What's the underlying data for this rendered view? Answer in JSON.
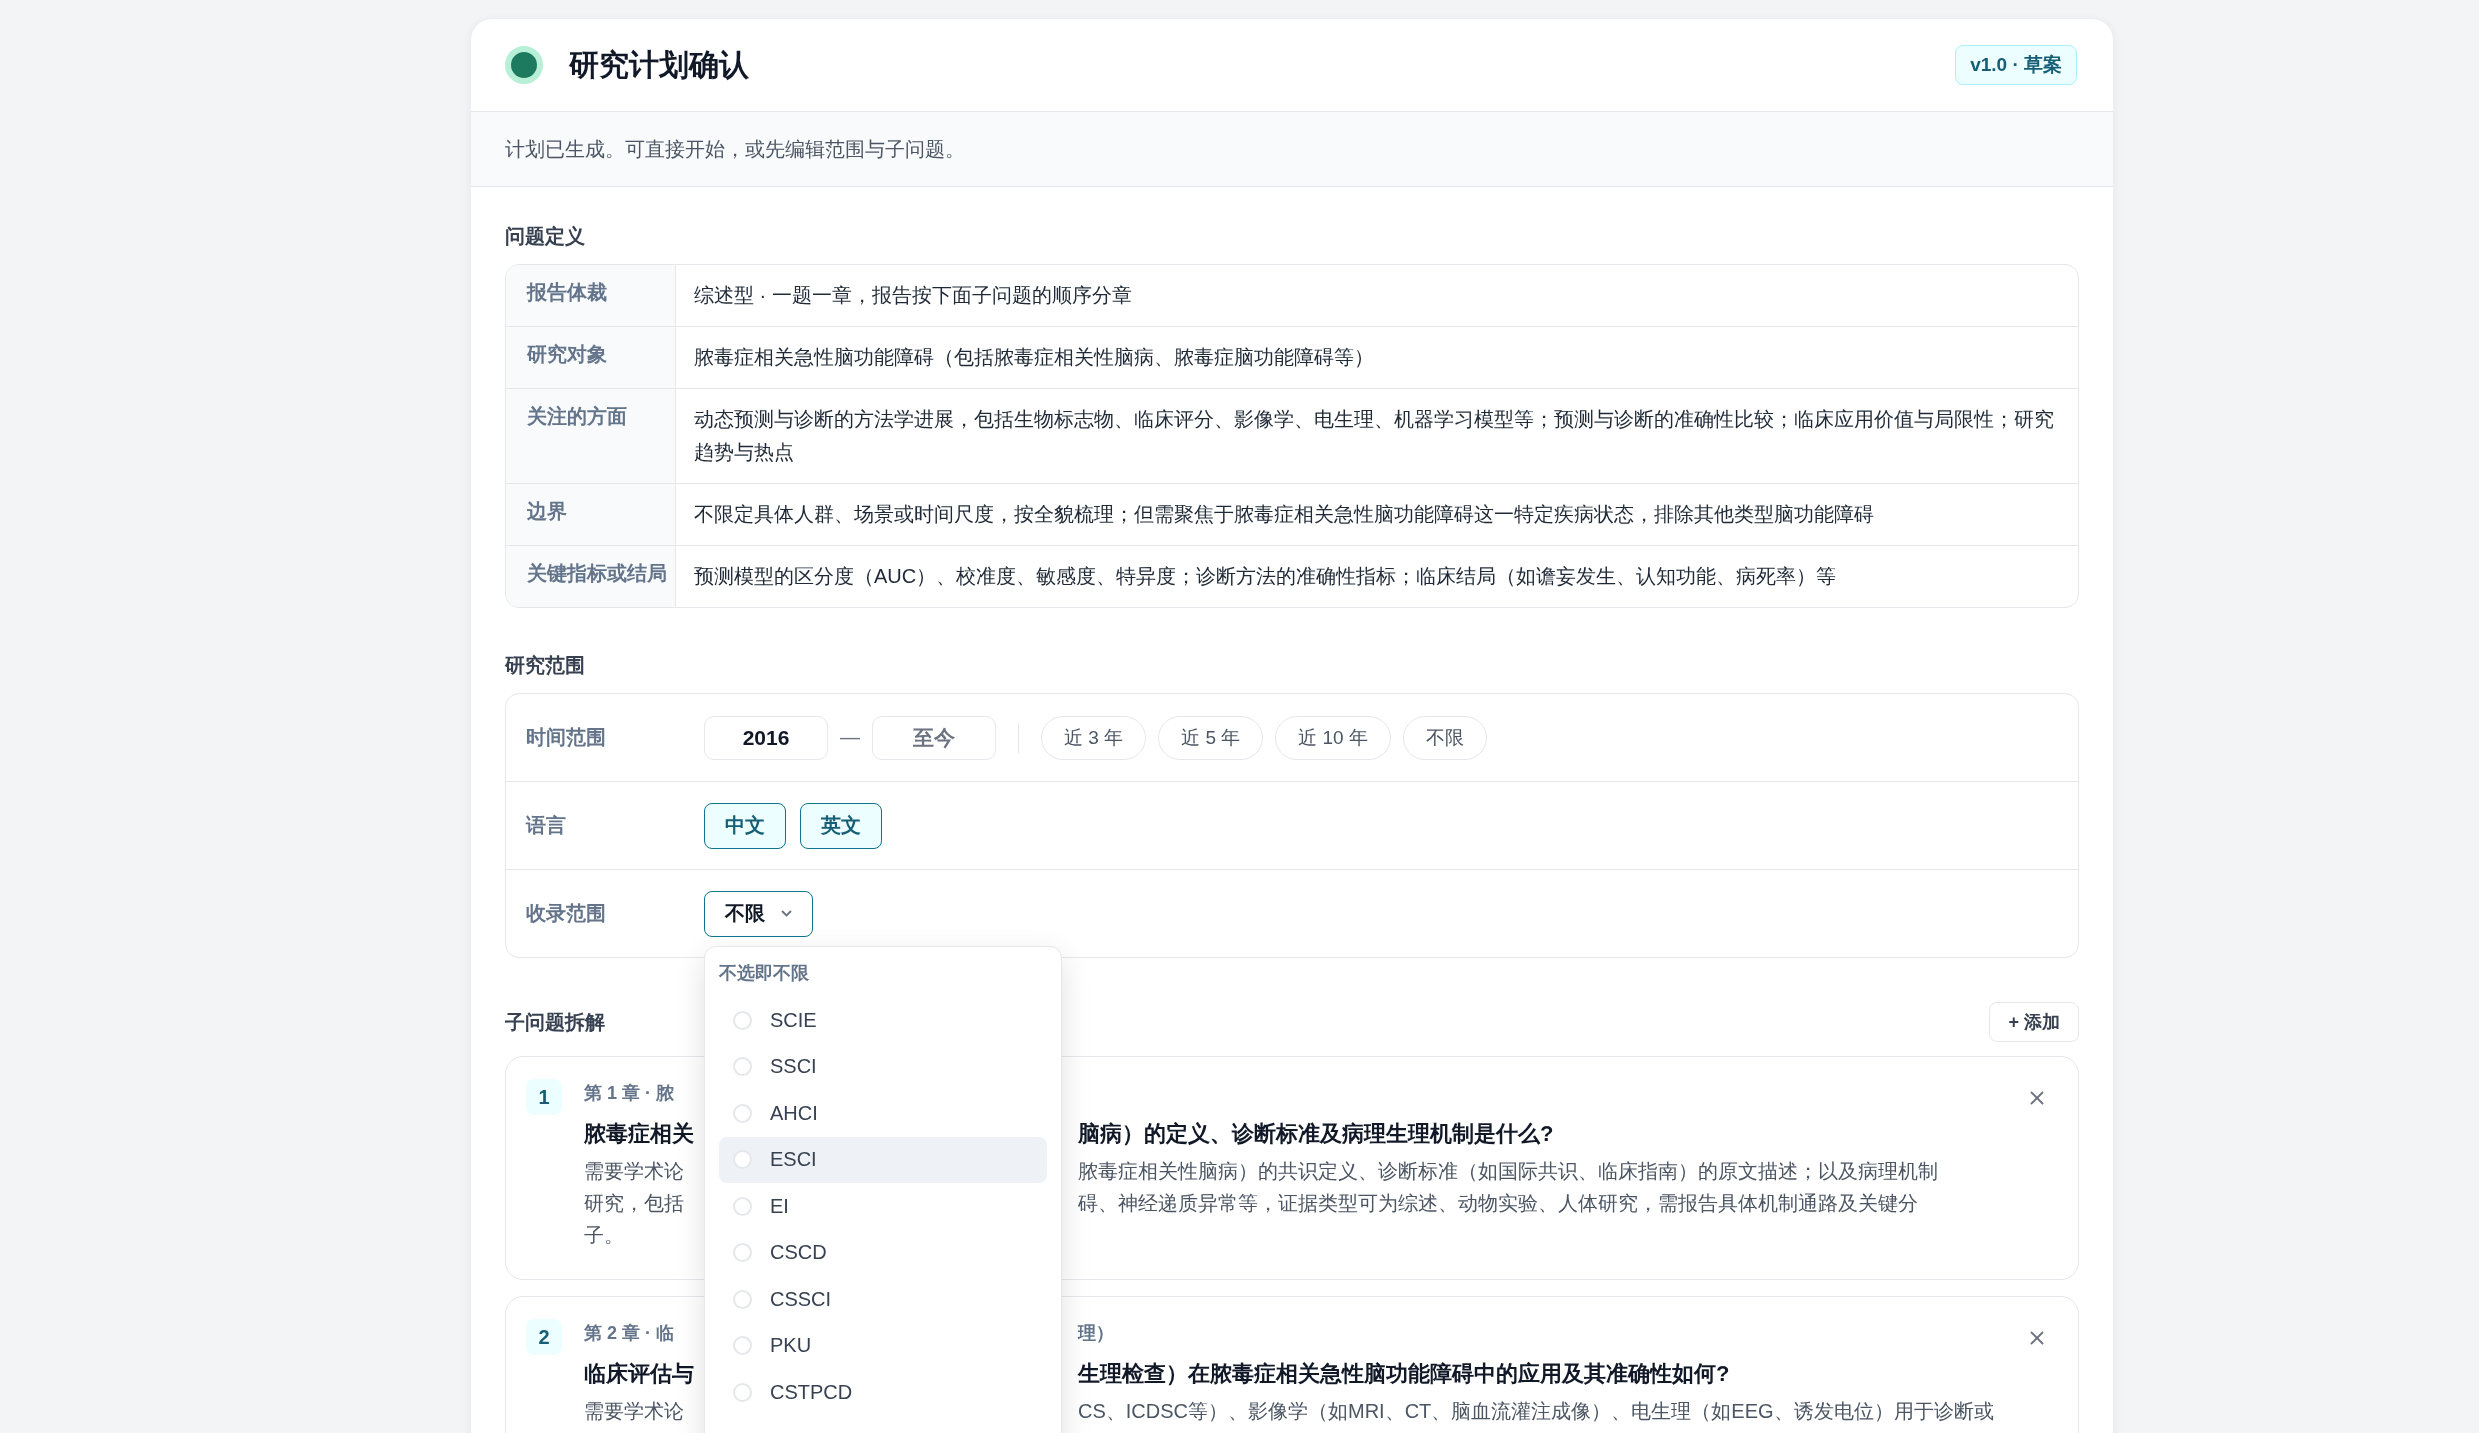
{
  "header": {
    "title": "研究计划确认",
    "badge": "v1.0 · 草案",
    "status_on": true
  },
  "notice": "计划已生成。可直接开始，或先编辑范围与子问题。",
  "definition": {
    "heading": "问题定义",
    "rows": [
      {
        "label": "报告体裁",
        "value": "综述型 · 一题一章，报告按下面子问题的顺序分章"
      },
      {
        "label": "研究对象",
        "value": "脓毒症相关急性脑功能障碍（包括脓毒症相关性脑病、脓毒症脑功能障碍等）"
      },
      {
        "label": "关注的方面",
        "value": "动态预测与诊断的方法学进展，包括生物标志物、临床评分、影像学、电生理、机器学习模型等；预测与诊断的准确性比较；临床应用价值与局限性；研究趋势与热点"
      },
      {
        "label": "边界",
        "value": "不限定具体人群、场景或时间尺度，按全貌梳理；但需聚焦于脓毒症相关急性脑功能障碍这一特定疾病状态，排除其他类型脑功能障碍"
      },
      {
        "label": "关键指标或结局",
        "value": "预测模型的区分度（AUC）、校准度、敏感度、特异度；诊断方法的准确性指标；临床结局（如谵妄发生、认知功能、病死率）等"
      }
    ]
  },
  "scope": {
    "heading": "研究范围",
    "time": {
      "label": "时间范围",
      "from": "2016",
      "separator": "—",
      "to_placeholder": "至今",
      "presets": [
        {
          "label": "近 3 年",
          "selected": false
        },
        {
          "label": "近 5 年",
          "selected": false
        },
        {
          "label": "近 10 年",
          "selected": false
        },
        {
          "label": "不限",
          "selected": false
        }
      ]
    },
    "language": {
      "label": "语言",
      "options": [
        {
          "label": "中文",
          "selected": true
        },
        {
          "label": "英文",
          "selected": true
        }
      ]
    },
    "index": {
      "label": "收录范围",
      "value": "不限",
      "expanded": true,
      "dropdown": {
        "hint": "不选即不限",
        "options": [
          {
            "label": "SCIE",
            "checked": false,
            "hovered": false
          },
          {
            "label": "SSCI",
            "checked": false,
            "hovered": false
          },
          {
            "label": "AHCI",
            "checked": false,
            "hovered": false
          },
          {
            "label": "ESCI",
            "checked": false,
            "hovered": true
          },
          {
            "label": "EI",
            "checked": false,
            "hovered": false
          },
          {
            "label": "CSCD",
            "checked": false,
            "hovered": false
          },
          {
            "label": "CSSCI",
            "checked": false,
            "hovered": false
          },
          {
            "label": "PKU",
            "checked": false,
            "hovered": false
          },
          {
            "label": "CSTPCD",
            "checked": false,
            "hovered": false
          }
        ]
      }
    }
  },
  "subquestions": {
    "heading": "子问题拆解",
    "add_button": "+ 添加",
    "items": [
      {
        "number": "1",
        "meta": [
          "第 1 章 · 脓"
        ],
        "title": [
          "脓毒症相关",
          "脑病）的定义、诊断标准及病理生理机制是什么?"
        ],
        "description": [
          [
            "需要学术论",
            "脓毒症相关性脑病）的共识定义、诊断标准（如国际共识、临床指南）的原文描述；以及病理机制"
          ],
          [
            "研究，包括",
            "碍、神经递质异常等，证据类型可为综述、动物实验、人体研究，需报告具体机制通路及关键分"
          ],
          [
            "子。"
          ]
        ]
      },
      {
        "number": "2",
        "meta": [
          "第 2 章 · 临",
          "理）"
        ],
        "title": [
          "临床评估与",
          "生理检查）在脓毒症相关急性脑功能障碍中的应用及其准确性如何?"
        ],
        "description": [
          [
            "需要学术论",
            "CS、ICDSC等）、影像学（如MRI、CT、脑血流灌注成像）、电生理（如EEG、诱发电位）用于诊断或"
          ]
        ]
      }
    ]
  }
}
